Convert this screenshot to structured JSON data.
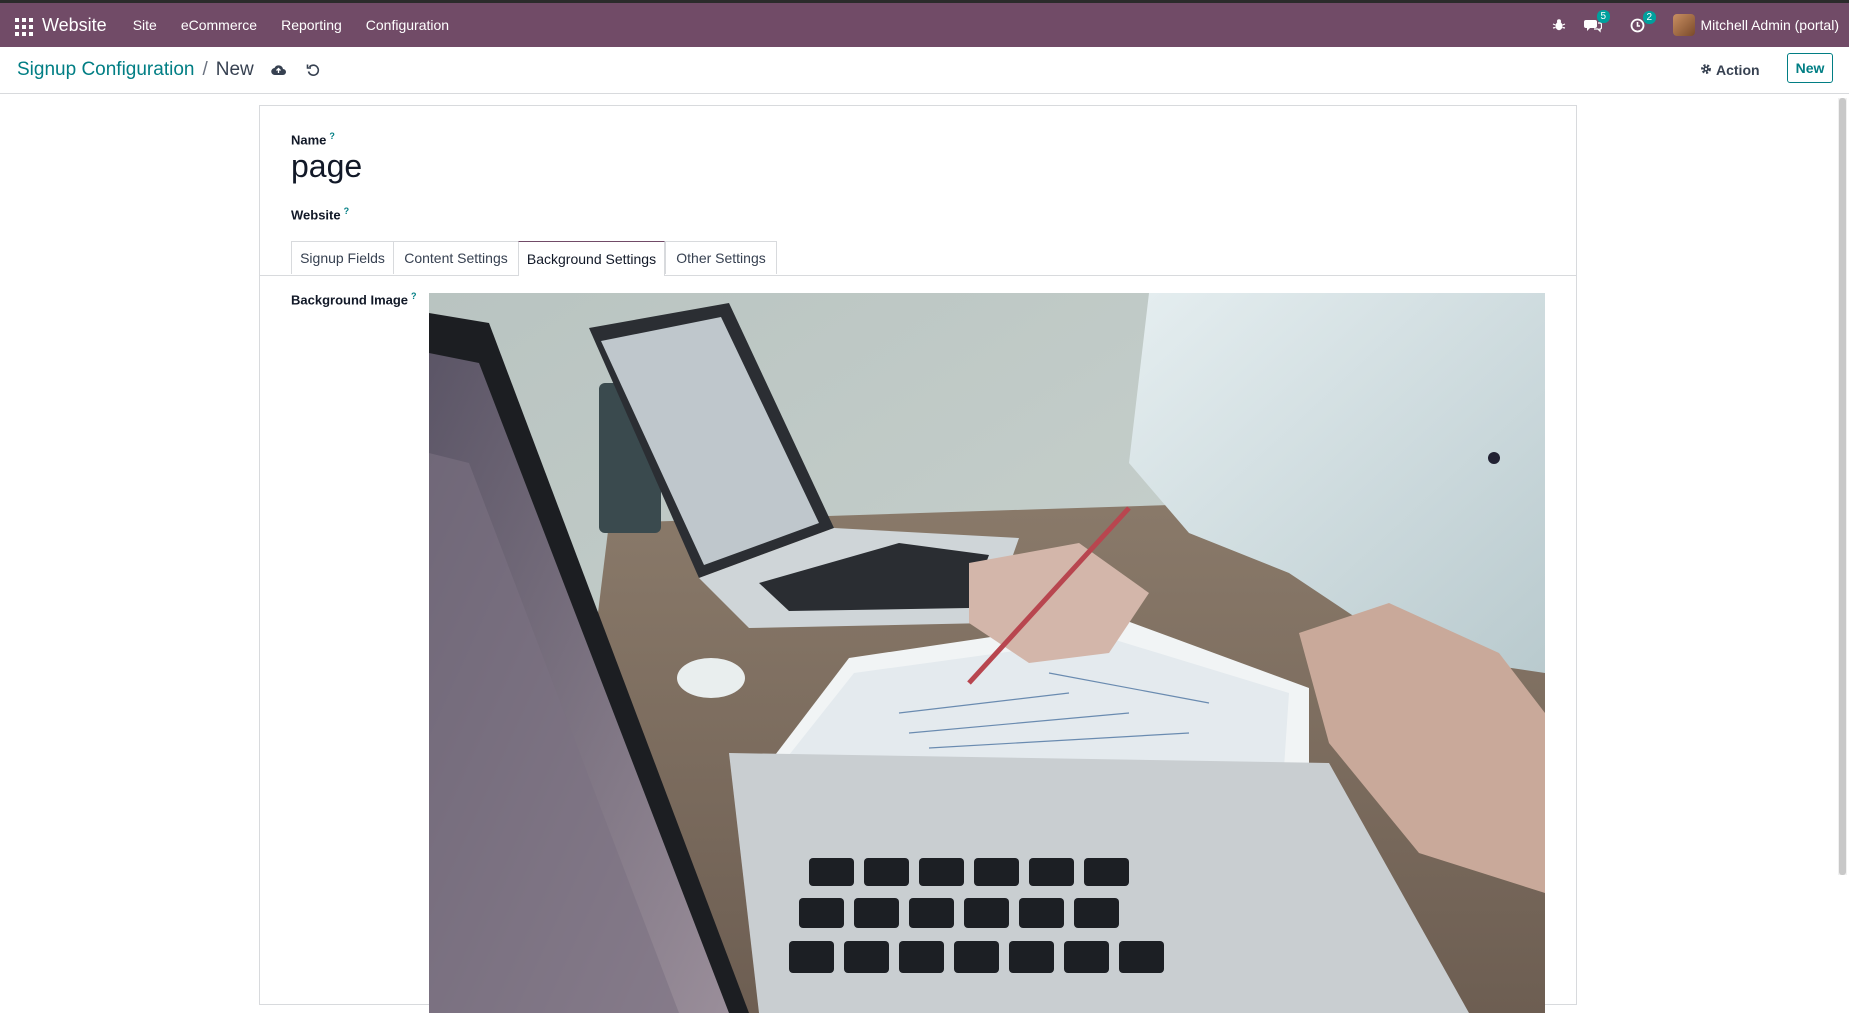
{
  "navbar": {
    "brand": "Website",
    "menu": [
      "Site",
      "eCommerce",
      "Reporting",
      "Configuration"
    ],
    "messages_count": "5",
    "activities_count": "2",
    "user_name": "Mitchell Admin (portal)",
    "icons": [
      "apps-grid-icon",
      "bug-icon",
      "chat-icon",
      "clock-icon"
    ],
    "color": "#714b67"
  },
  "breadcrumb": {
    "parent": "Signup Configuration",
    "separator": "/",
    "current": "New"
  },
  "control": {
    "action_label": "Action",
    "new_label": "New",
    "icons": [
      "cloud-save-icon",
      "discard-icon",
      "gear-icon"
    ]
  },
  "form": {
    "name_label": "Name",
    "name_help": "?",
    "name_value": "page",
    "website_label": "Website",
    "website_help": "?",
    "tabs": [
      "Signup Fields",
      "Content Settings",
      "Background Settings",
      "Other Settings"
    ],
    "active_tab": "Background Settings",
    "background_label": "Background Image",
    "background_help": "?"
  },
  "accent_color": "#017e84"
}
